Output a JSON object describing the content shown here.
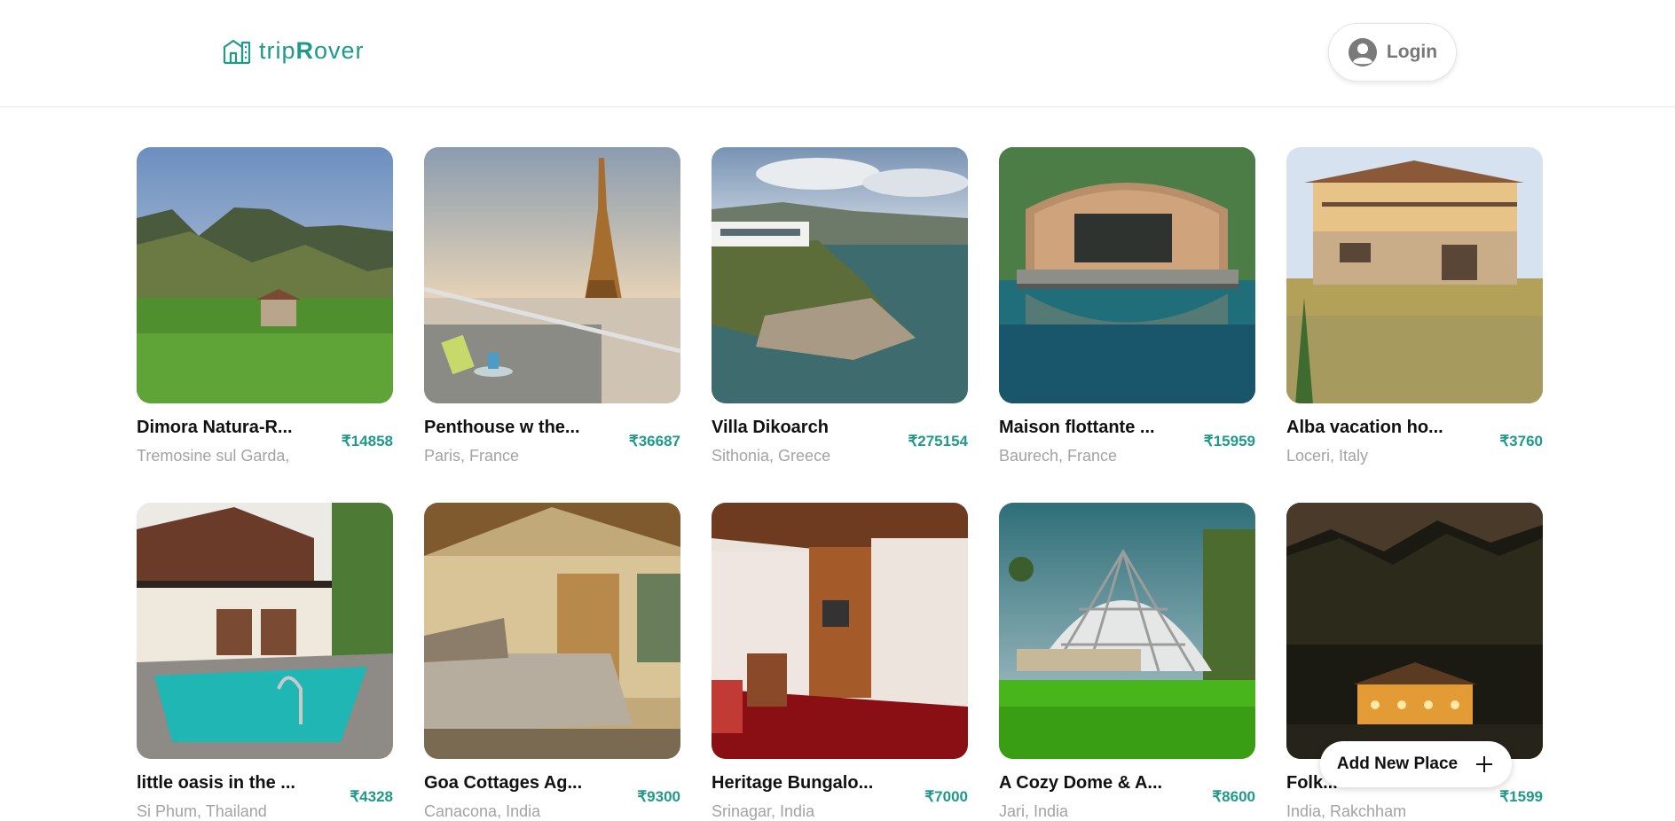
{
  "brand": {
    "prefix": "trip",
    "accent": "R",
    "suffix": "over",
    "color": "#1f9a8a"
  },
  "header": {
    "login_label": "Login"
  },
  "listings": [
    {
      "title": "Dimora Natura-R...",
      "location": "Tremosine sul Garda,",
      "price": "₹14858"
    },
    {
      "title": "Penthouse w the...",
      "location": "Paris, France",
      "price": "₹36687"
    },
    {
      "title": "Villa Dikoarch",
      "location": "Sithonia, Greece",
      "price": "₹275154"
    },
    {
      "title": "Maison flottante ...",
      "location": "Baurech, France",
      "price": "₹15959"
    },
    {
      "title": "Alba vacation ho...",
      "location": "Loceri, Italy",
      "price": "₹3760"
    },
    {
      "title": "little oasis in the ...",
      "location": "Si Phum, Thailand",
      "price": "₹4328"
    },
    {
      "title": "Goa Cottages Ag...",
      "location": "Canacona, India",
      "price": "₹9300"
    },
    {
      "title": "Heritage Bungalo...",
      "location": "Srinagar, India",
      "price": "₹7000"
    },
    {
      "title": "A Cozy Dome & A...",
      "location": "Jari, India",
      "price": "₹8600"
    },
    {
      "title": "Folk...",
      "location": "India, Rakchham",
      "price": "₹1599"
    }
  ],
  "fab": {
    "label": "Add New Place",
    "icon": "plus-icon"
  }
}
